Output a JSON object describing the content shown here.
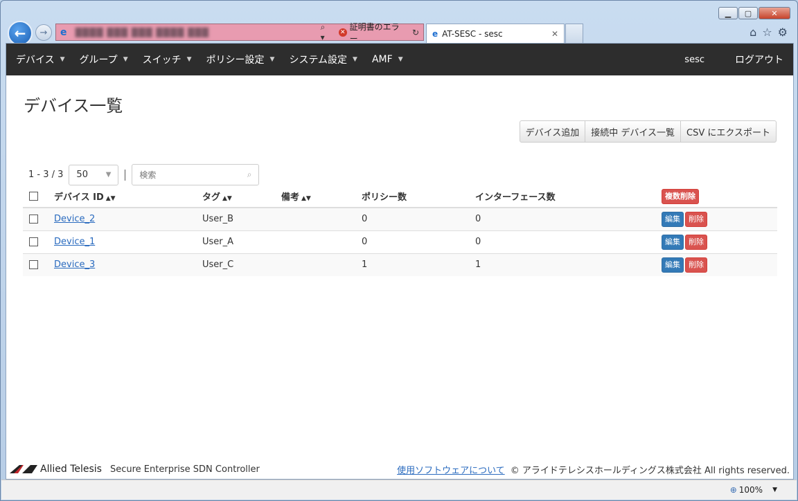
{
  "browser": {
    "tab_title": "AT-SESC - sesc",
    "cert_error": "証明書のエラー",
    "zoom": "100%"
  },
  "nav": {
    "items": [
      {
        "label": "デバイス"
      },
      {
        "label": "グループ"
      },
      {
        "label": "スイッチ"
      },
      {
        "label": "ポリシー設定"
      },
      {
        "label": "システム設定"
      },
      {
        "label": "AMF"
      }
    ],
    "user": "sesc",
    "logout": "ログアウト"
  },
  "page": {
    "title": "デバイス一覧",
    "actions": {
      "add": "デバイス追加",
      "connected": "接続中 デバイス一覧",
      "export": "CSV にエクスポート"
    },
    "pager": {
      "count": "1 - 3 / 3",
      "page_size": "50"
    },
    "search": {
      "placeholder": "検索"
    }
  },
  "table": {
    "headers": {
      "device_id": "デバイス ID",
      "tag": "タグ",
      "note": "備考",
      "policy_count": "ポリシー数",
      "interface_count": "インターフェース数",
      "bulk_delete": "複数削除"
    },
    "rows": [
      {
        "device_id": "Device_2",
        "tag": "User_B",
        "note": "",
        "policy_count": "0",
        "interface_count": "0"
      },
      {
        "device_id": "Device_1",
        "tag": "User_A",
        "note": "",
        "policy_count": "0",
        "interface_count": "0"
      },
      {
        "device_id": "Device_3",
        "tag": "User_C",
        "note": "",
        "policy_count": "1",
        "interface_count": "1"
      }
    ],
    "edit_label": "編集",
    "delete_label": "削除"
  },
  "footer": {
    "brand": "Allied Telesis",
    "product": "Secure Enterprise SDN Controller",
    "link": "使用ソフトウェアについて",
    "copyright": "© アライドテレシスホールディングス株式会社 All rights reserved."
  }
}
